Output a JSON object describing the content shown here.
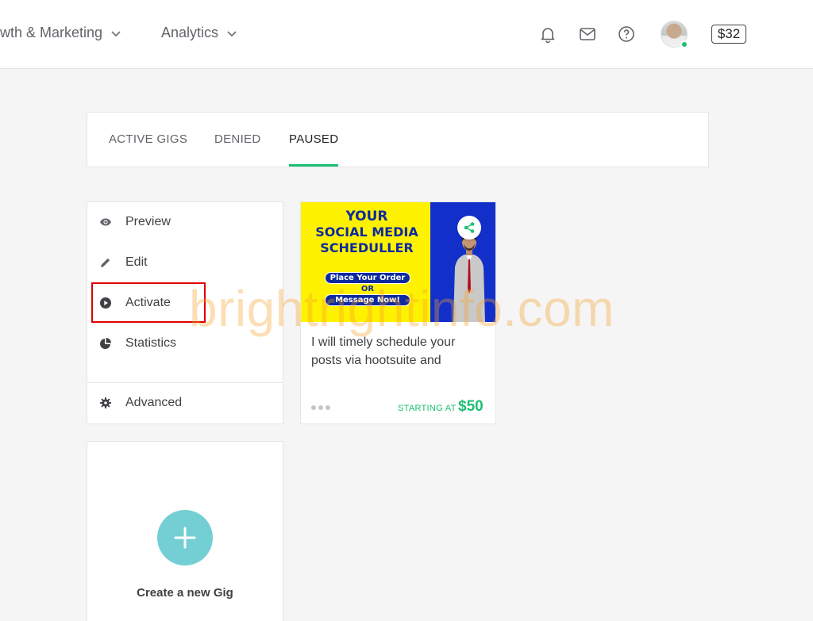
{
  "topbar": {
    "nav": [
      {
        "label": "wth & Marketing"
      },
      {
        "label": "Analytics"
      }
    ],
    "icons": [
      "bell-icon",
      "mail-icon",
      "help-icon"
    ],
    "balance": "$32",
    "avatar_status": "online"
  },
  "tabs": [
    {
      "label": "ACTIVE GIGS",
      "active": false
    },
    {
      "label": "DENIED",
      "active": false
    },
    {
      "label": "PAUSED",
      "active": true
    }
  ],
  "context_menu": {
    "items": [
      {
        "label": "Preview",
        "icon": "eye-icon"
      },
      {
        "label": "Edit",
        "icon": "pencil-icon"
      },
      {
        "label": "Activate",
        "icon": "play-circle-icon",
        "highlighted": true
      },
      {
        "label": "Statistics",
        "icon": "pie-chart-icon"
      }
    ],
    "advanced": {
      "label": "Advanced",
      "icon": "gear-icon"
    }
  },
  "gig": {
    "thumbnail": {
      "line1": "YOUR",
      "line2": "SOCIAL MEDIA",
      "line3": "SCHEDULLER",
      "cta1": "Place Your Order",
      "cta_or": "OR",
      "cta2": "Message Now!"
    },
    "title": "I will timely schedule your posts via hootsuite and",
    "starting_at": "STARTING AT",
    "price": "$50"
  },
  "create": {
    "label": "Create a new Gig"
  },
  "watermark": "brightrightinfo.com",
  "colors": {
    "accent_green": "#1dbf73",
    "highlight_red": "#e00000",
    "plus_teal": "#74cfd4",
    "thumb_yellow": "#fff200",
    "thumb_blue": "#1230c9"
  }
}
